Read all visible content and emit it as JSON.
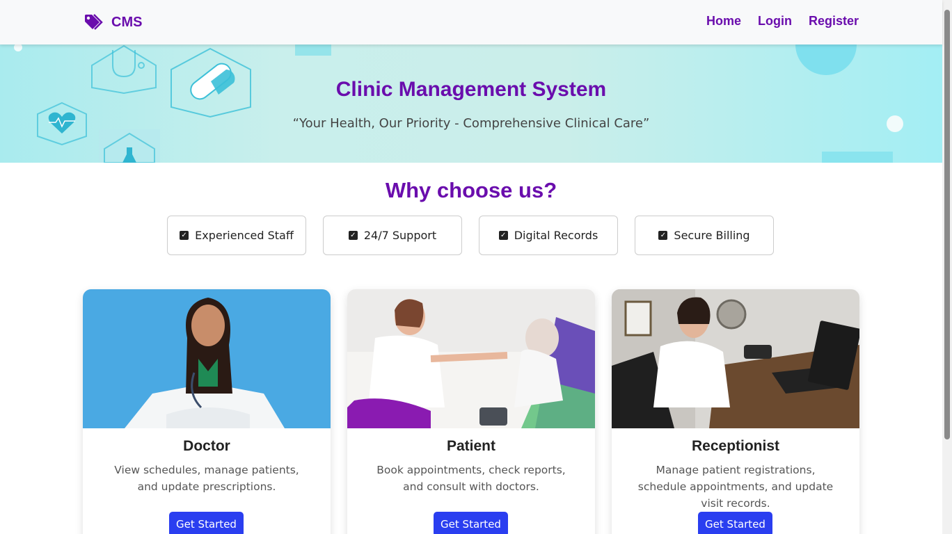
{
  "navbar": {
    "brand": "CMS",
    "brand_icon": "tag-icon",
    "links": [
      "Home",
      "Login",
      "Register"
    ]
  },
  "hero": {
    "title": "Clinic Management System",
    "subtitle": "“Your Health, Our Priority - Comprehensive Clinical Care”"
  },
  "why": {
    "title": "Why choose us?",
    "features": [
      "Experienced Staff",
      "24/7 Support",
      "Digital Records",
      "Secure Billing"
    ]
  },
  "cards": [
    {
      "title": "Doctor",
      "desc": "View schedules, manage patients, and update prescriptions.",
      "button": "Get Started"
    },
    {
      "title": "Patient",
      "desc": "Book appointments, check reports, and consult with doctors.",
      "button": "Get Started"
    },
    {
      "title": "Receptionist",
      "desc": "Manage patient registrations, schedule appointments, and update visit records.",
      "button": "Get Started"
    }
  ],
  "colors": {
    "brand": "#6a0dad",
    "button": "#2a3ef0",
    "hero_bg": "#c9efec"
  }
}
